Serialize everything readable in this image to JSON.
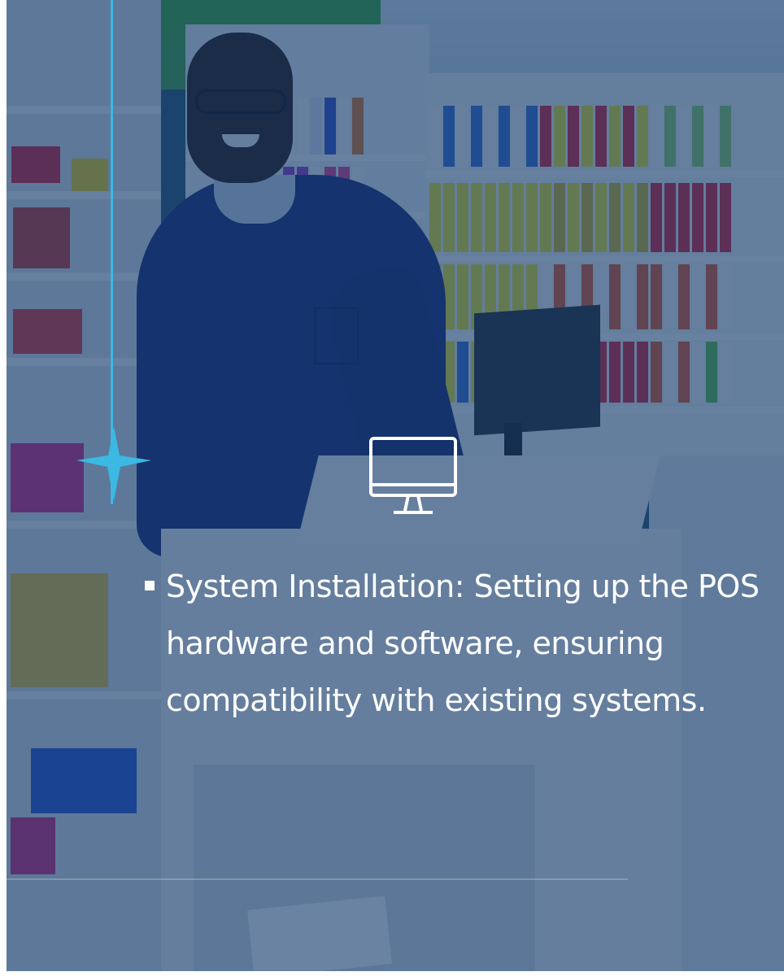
{
  "card": {
    "icon": "monitor-icon",
    "decoration_icon": "sparkle-star-icon",
    "accent_color": "#3bb8e3",
    "overlay_color": "#103769",
    "text_color": "#ffffff",
    "bullets": [
      {
        "text": "System Installation: Setting up the POS hardware and software, ensuring compatibility with existing systems."
      }
    ]
  }
}
